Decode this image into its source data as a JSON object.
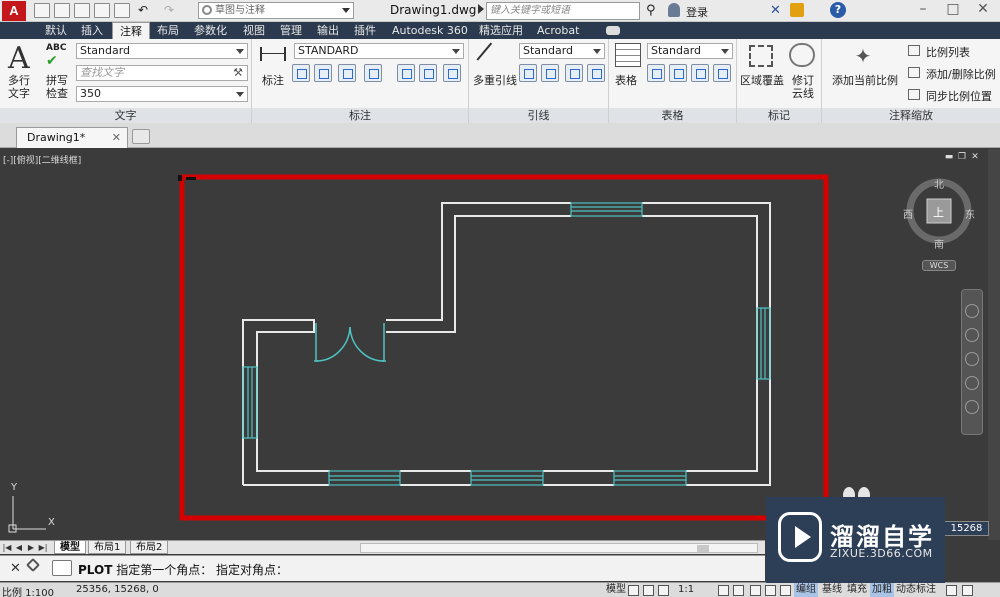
{
  "app": {
    "logo": "A",
    "workspace": "草图与注释",
    "document_title": "Drawing1.dwg",
    "search_placeholder": "键入关键字或短语",
    "user": "登录",
    "help": "?"
  },
  "ribbon_tabs": [
    "默认",
    "插入",
    "注释",
    "布局",
    "参数化",
    "视图",
    "管理",
    "输出",
    "插件",
    "Autodesk 360",
    "精选应用",
    "Acrobat"
  ],
  "active_tab": "注释",
  "ribbon": {
    "text_panel": {
      "title": "文字",
      "multiline_label": "多行\n文字",
      "spell_label": "拼写\n检查",
      "style_value": "Standard",
      "find_placeholder": "查找文字",
      "height_value": "350"
    },
    "dim_panel": {
      "title": "标注",
      "dim_label": "标注",
      "style_value": "STANDARD"
    },
    "leader_panel": {
      "title": "引线",
      "multileader_label": "多重引线",
      "style_value": "Standard"
    },
    "table_panel": {
      "title": "表格",
      "table_label": "表格",
      "style_value": "Standard"
    },
    "markup_panel": {
      "title": "标记",
      "wipeout_label": "区域覆盖",
      "revcloud_label": "修订\n云线"
    },
    "scale_panel": {
      "title": "注释缩放",
      "add_scale_label": "添加当前比例",
      "scale_list": "比例列表",
      "add_delete_scale": "添加/删除比例",
      "sync_scale": "同步比例位置"
    }
  },
  "document_tab": "Drawing1*",
  "viewport": {
    "label": "[-][俯视][二维线框]",
    "viewcube": {
      "north": "北",
      "south": "南",
      "east": "东",
      "west": "西",
      "top": "上"
    },
    "wcs": "WCS",
    "ucs_x": "X",
    "ucs_y": "Y"
  },
  "layout_tabs": [
    "模型",
    "布局1",
    "布局2"
  ],
  "active_layout": "模型",
  "command": {
    "name": "PLOT",
    "prompt": "指定第一个角点：  指定对角点："
  },
  "status": {
    "scale": "比例 1:100",
    "coordinates": "25356, 15268, 0",
    "model": "模型",
    "annotation_scale": "1:1",
    "toggles": [
      "编组",
      "基线",
      "填充",
      "加粗",
      "动态标注"
    ],
    "coord_badge": "15268"
  },
  "watermark": {
    "cn": "溜溜自学",
    "en": "ZIXUE.3D66.COM"
  },
  "colors": {
    "plot_window": "#d40000",
    "wall": "#e8e8e8",
    "window_door": "#4fc3c3",
    "canvas": "#3b3b3b"
  }
}
